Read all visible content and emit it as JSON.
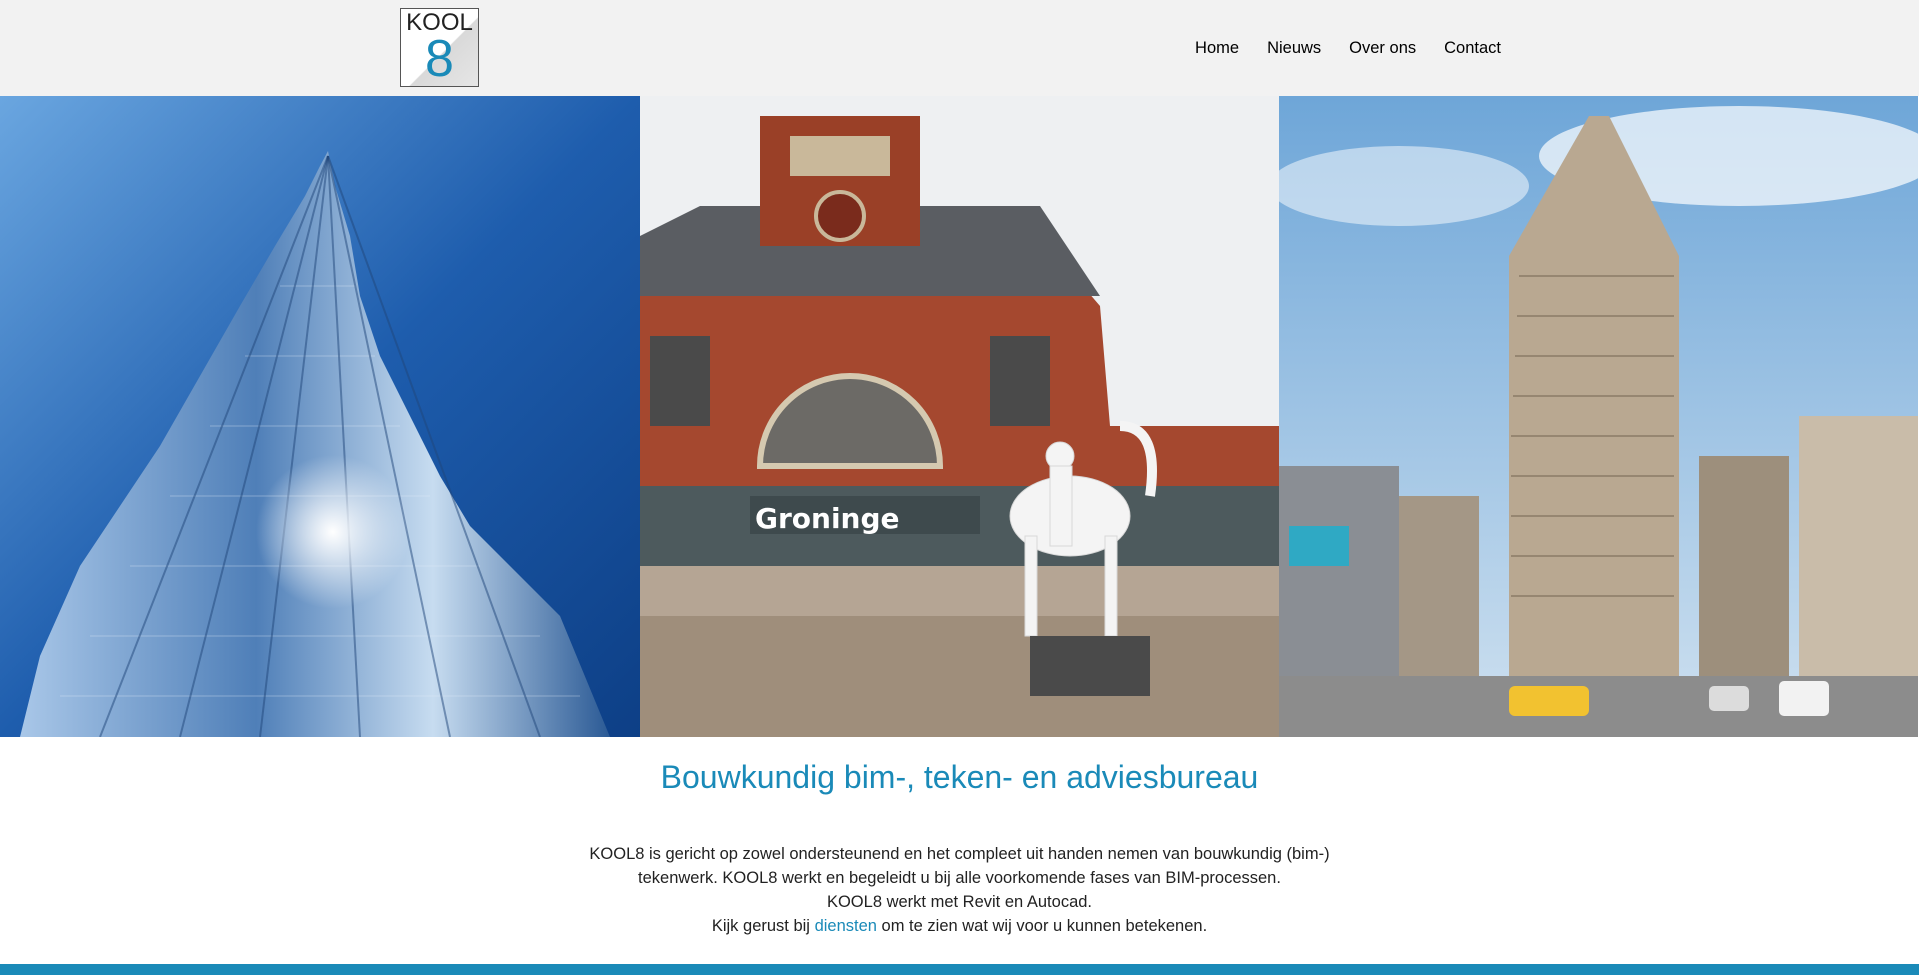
{
  "logo": {
    "text": "KOOL",
    "number": "8"
  },
  "nav": {
    "items": [
      "Home",
      "Nieuws",
      "Over ons",
      "Contact"
    ]
  },
  "hero": {
    "station_sign": "Groninge"
  },
  "main": {
    "title": "Bouwkundig bim-, teken- en adviesbureau",
    "intro_line1": "KOOL8 is gericht op zowel ondersteunend en het compleet uit handen nemen van bouwkundig (bim-)",
    "intro_line2": "tekenwerk. KOOL8 werkt en begeleidt u bij alle voorkomende fases van BIM-processen.",
    "intro_line3": "KOOL8 werkt met Revit en Autocad.",
    "intro_line4_before": "Kijk gerust bij",
    "intro_line4_link": "diensten",
    "intro_line4_after": "om te zien wat wij voor u kunnen betekenen."
  },
  "colors": {
    "accent": "#1a8ab8",
    "header_bg": "#f2f2f2"
  }
}
